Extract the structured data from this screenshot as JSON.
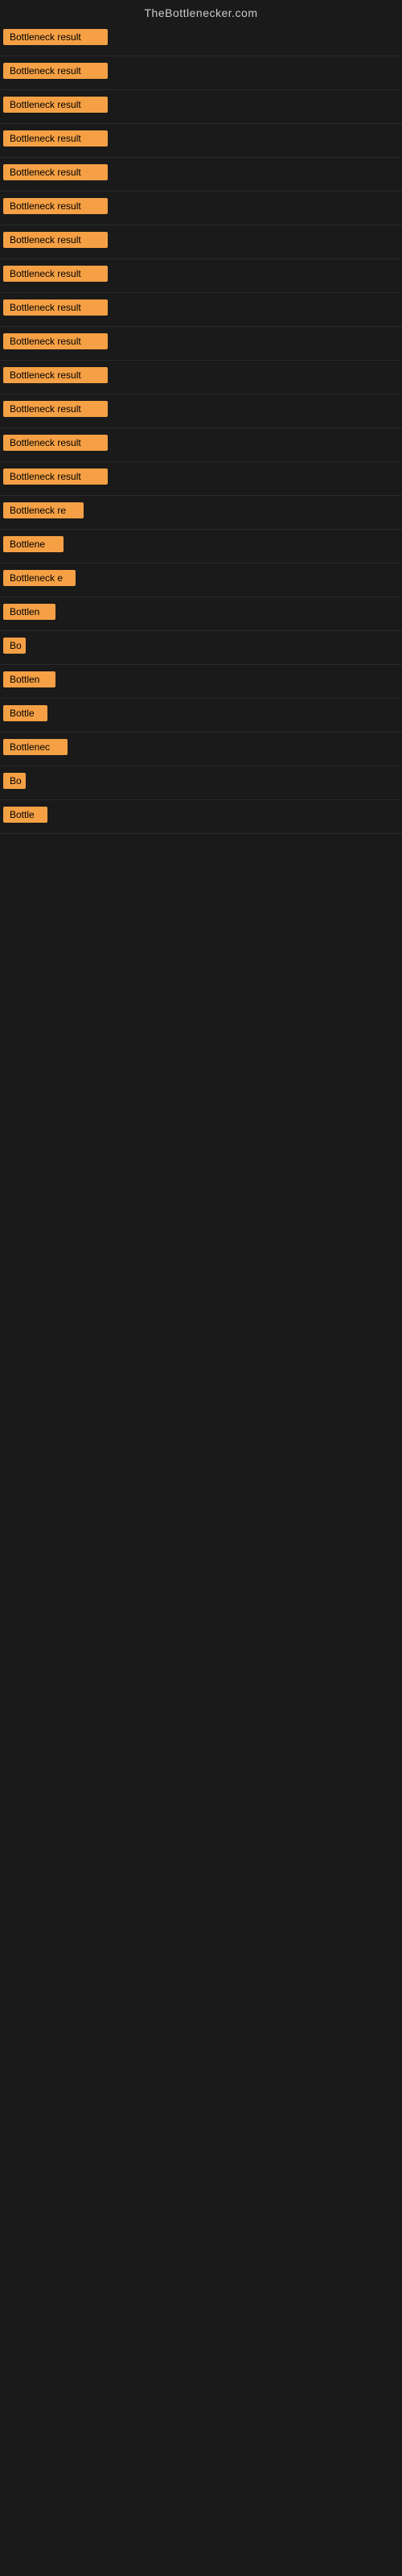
{
  "site": {
    "title": "TheBottlenecker.com"
  },
  "rows": [
    {
      "id": 1,
      "label": "Bottleneck result",
      "width": 130
    },
    {
      "id": 2,
      "label": "Bottleneck result",
      "width": 130
    },
    {
      "id": 3,
      "label": "Bottleneck result",
      "width": 130
    },
    {
      "id": 4,
      "label": "Bottleneck result",
      "width": 130
    },
    {
      "id": 5,
      "label": "Bottleneck result",
      "width": 130
    },
    {
      "id": 6,
      "label": "Bottleneck result",
      "width": 130
    },
    {
      "id": 7,
      "label": "Bottleneck result",
      "width": 130
    },
    {
      "id": 8,
      "label": "Bottleneck result",
      "width": 130
    },
    {
      "id": 9,
      "label": "Bottleneck result",
      "width": 130
    },
    {
      "id": 10,
      "label": "Bottleneck result",
      "width": 130
    },
    {
      "id": 11,
      "label": "Bottleneck result",
      "width": 130
    },
    {
      "id": 12,
      "label": "Bottleneck result",
      "width": 130
    },
    {
      "id": 13,
      "label": "Bottleneck result",
      "width": 130
    },
    {
      "id": 14,
      "label": "Bottleneck result",
      "width": 130
    },
    {
      "id": 15,
      "label": "Bottleneck re",
      "width": 100
    },
    {
      "id": 16,
      "label": "Bottlene",
      "width": 75
    },
    {
      "id": 17,
      "label": "Bottleneck e",
      "width": 90
    },
    {
      "id": 18,
      "label": "Bottlen",
      "width": 65
    },
    {
      "id": 19,
      "label": "Bo",
      "width": 28
    },
    {
      "id": 20,
      "label": "Bottlen",
      "width": 65
    },
    {
      "id": 21,
      "label": "Bottle",
      "width": 55
    },
    {
      "id": 22,
      "label": "Bottlenec",
      "width": 80
    },
    {
      "id": 23,
      "label": "Bo",
      "width": 28
    },
    {
      "id": 24,
      "label": "Bottle",
      "width": 55
    }
  ]
}
